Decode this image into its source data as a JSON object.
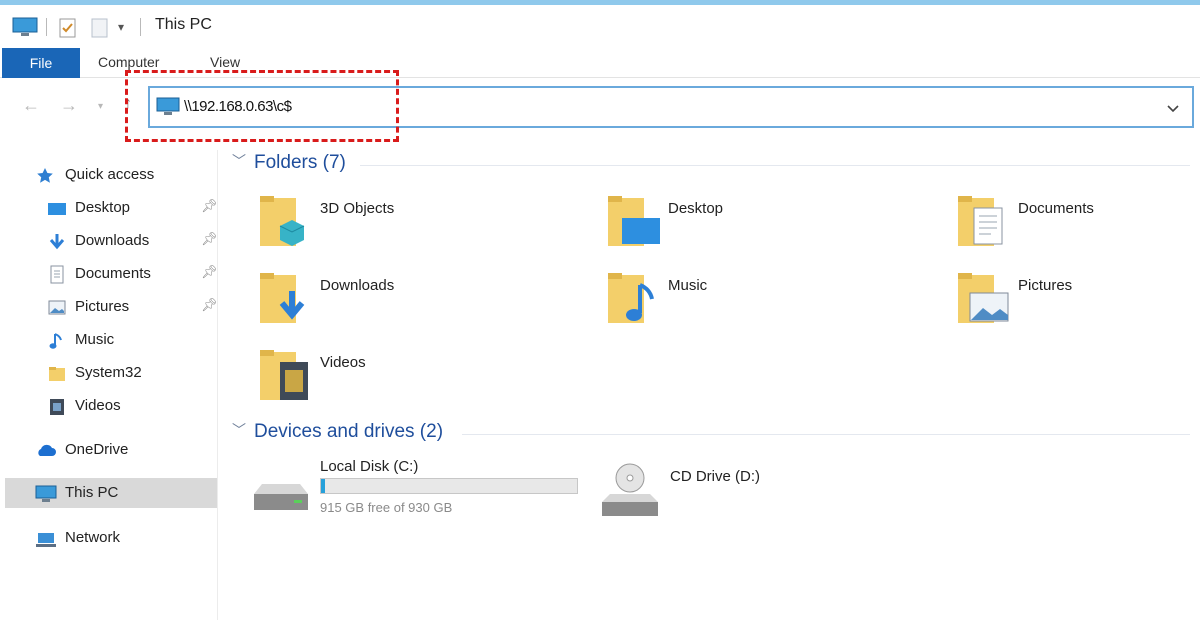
{
  "window": {
    "title": "This PC"
  },
  "ribbon": {
    "file_tab": "File",
    "tabs": [
      "Computer",
      "View"
    ]
  },
  "address": {
    "path": "\\\\192.168.0.63\\c$"
  },
  "sidebar": {
    "quick_access": "Quick access",
    "items": [
      {
        "label": "Desktop",
        "icon": "desktop-icon",
        "pinned": true
      },
      {
        "label": "Downloads",
        "icon": "downloads-icon",
        "pinned": true
      },
      {
        "label": "Documents",
        "icon": "documents-icon",
        "pinned": true
      },
      {
        "label": "Pictures",
        "icon": "pictures-icon",
        "pinned": true
      },
      {
        "label": "Music",
        "icon": "music-icon",
        "pinned": false
      },
      {
        "label": "System32",
        "icon": "folder-icon",
        "pinned": false
      },
      {
        "label": "Videos",
        "icon": "videos-icon",
        "pinned": false
      }
    ],
    "onedrive": "OneDrive",
    "this_pc": "This PC",
    "network": "Network"
  },
  "folders": {
    "header": "Folders (7)",
    "items": [
      {
        "label": "3D Objects",
        "icon": "3d-objects-icon"
      },
      {
        "label": "Desktop",
        "icon": "desktop-folder-icon"
      },
      {
        "label": "Documents",
        "icon": "documents-folder-icon"
      },
      {
        "label": "Downloads",
        "icon": "downloads-folder-icon"
      },
      {
        "label": "Music",
        "icon": "music-folder-icon"
      },
      {
        "label": "Pictures",
        "icon": "pictures-folder-icon"
      },
      {
        "label": "Videos",
        "icon": "videos-folder-icon"
      }
    ]
  },
  "devices": {
    "header": "Devices and drives (2)",
    "drives": [
      {
        "label": "Local Disk (C:)",
        "free": "915 GB free of 930 GB",
        "used_fraction": 0.016,
        "icon": "hard-drive-icon"
      },
      {
        "label": "CD Drive (D:)",
        "icon": "cd-drive-icon"
      }
    ]
  },
  "colors": {
    "accent": "#1a66b7",
    "highlight": "#d91b1b",
    "selection": "#d9d9d9",
    "drive_fill": "#26a0da"
  }
}
